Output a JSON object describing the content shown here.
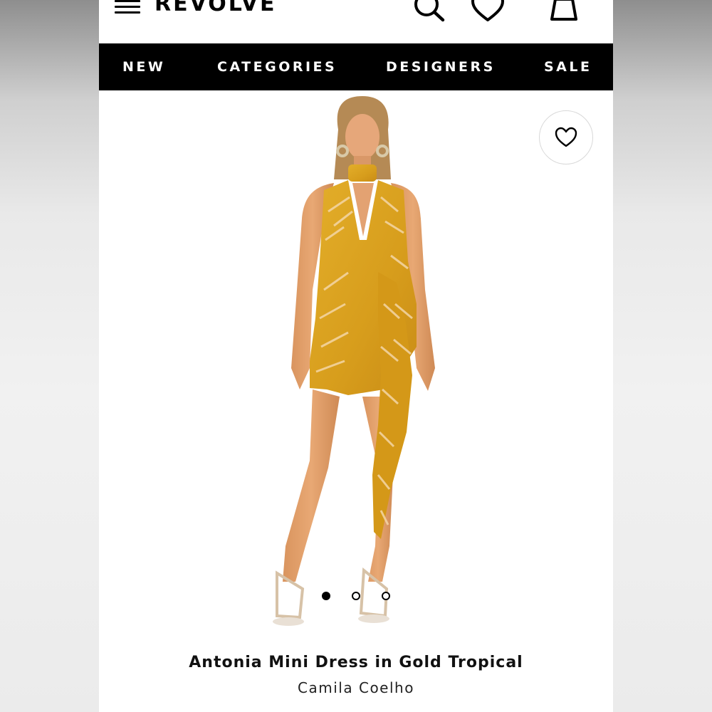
{
  "header": {
    "logo": "REVOLVE",
    "icons": [
      "menu-icon",
      "search-icon",
      "heart-icon",
      "bag-icon"
    ]
  },
  "nav": {
    "items": [
      {
        "label": "NEW"
      },
      {
        "label": "CATEGORIES"
      },
      {
        "label": "DESIGNERS"
      },
      {
        "label": "SALE"
      }
    ]
  },
  "product": {
    "name": "Antonia Mini Dress in Gold Tropical",
    "designer": "Camila Coelho",
    "image_count": 3,
    "active_image": 1,
    "dress_color": "#d9a420"
  },
  "colors": {
    "nav_background": "#000000",
    "nav_text": "#ffffff",
    "page_background": "#ffffff"
  }
}
